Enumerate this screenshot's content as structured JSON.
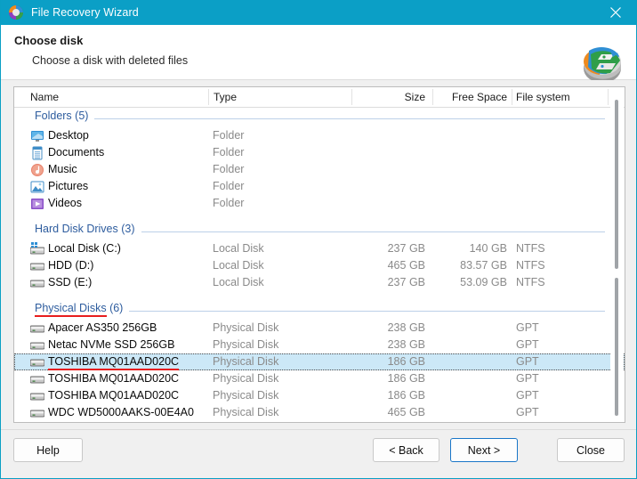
{
  "window": {
    "title": "File Recovery Wizard",
    "app_icon": "recovery-wizard-icon",
    "close_icon": "close-icon",
    "titlebar_color": "#0b9fc6"
  },
  "header": {
    "title": "Choose disk",
    "subtitle": "Choose a disk with deleted files",
    "icon": "disk-recovery-illustration"
  },
  "columns": [
    {
      "key": "name",
      "label": "Name"
    },
    {
      "key": "type",
      "label": "Type"
    },
    {
      "key": "size",
      "label": "Size"
    },
    {
      "key": "free",
      "label": "Free Space"
    },
    {
      "key": "fs",
      "label": "File system"
    }
  ],
  "groups": [
    {
      "name": "Folders",
      "count": "(5)",
      "annotated": false,
      "rows": [
        {
          "icon": "desktop-folder-icon",
          "name": "Desktop",
          "type": "Folder",
          "size": "",
          "free": "",
          "fs": "",
          "selected": false,
          "annotated": false
        },
        {
          "icon": "documents-folder-icon",
          "name": "Documents",
          "type": "Folder",
          "size": "",
          "free": "",
          "fs": "",
          "selected": false,
          "annotated": false
        },
        {
          "icon": "music-folder-icon",
          "name": "Music",
          "type": "Folder",
          "size": "",
          "free": "",
          "fs": "",
          "selected": false,
          "annotated": false
        },
        {
          "icon": "pictures-folder-icon",
          "name": "Pictures",
          "type": "Folder",
          "size": "",
          "free": "",
          "fs": "",
          "selected": false,
          "annotated": false
        },
        {
          "icon": "videos-folder-icon",
          "name": "Videos",
          "type": "Folder",
          "size": "",
          "free": "",
          "fs": "",
          "selected": false,
          "annotated": false
        }
      ]
    },
    {
      "name": "Hard Disk Drives",
      "count": "(3)",
      "annotated": false,
      "rows": [
        {
          "icon": "system-drive-icon",
          "name": "Local Disk (C:)",
          "type": "Local Disk",
          "size": "237 GB",
          "free": "140 GB",
          "fs": "NTFS",
          "selected": false,
          "annotated": false
        },
        {
          "icon": "drive-icon",
          "name": "HDD (D:)",
          "type": "Local Disk",
          "size": "465 GB",
          "free": "83.57 GB",
          "fs": "NTFS",
          "selected": false,
          "annotated": false
        },
        {
          "icon": "drive-icon",
          "name": "SSD (E:)",
          "type": "Local Disk",
          "size": "237 GB",
          "free": "53.09 GB",
          "fs": "NTFS",
          "selected": false,
          "annotated": false
        }
      ]
    },
    {
      "name": "Physical Disks",
      "count": "(6)",
      "annotated": true,
      "rows": [
        {
          "icon": "drive-icon",
          "name": "Apacer AS350 256GB",
          "type": "Physical Disk",
          "size": "238 GB",
          "free": "",
          "fs": "GPT",
          "selected": false,
          "annotated": false
        },
        {
          "icon": "drive-icon",
          "name": "Netac NVMe SSD 256GB",
          "type": "Physical Disk",
          "size": "238 GB",
          "free": "",
          "fs": "GPT",
          "selected": false,
          "annotated": false
        },
        {
          "icon": "drive-icon",
          "name": "TOSHIBA MQ01AAD020C",
          "type": "Physical Disk",
          "size": "186 GB",
          "free": "",
          "fs": "GPT",
          "selected": true,
          "annotated": true
        },
        {
          "icon": "drive-icon",
          "name": "TOSHIBA MQ01AAD020C",
          "type": "Physical Disk",
          "size": "186 GB",
          "free": "",
          "fs": "GPT",
          "selected": false,
          "annotated": false
        },
        {
          "icon": "drive-icon",
          "name": "TOSHIBA MQ01AAD020C",
          "type": "Physical Disk",
          "size": "186 GB",
          "free": "",
          "fs": "GPT",
          "selected": false,
          "annotated": false
        },
        {
          "icon": "drive-icon",
          "name": "WDC WD5000AAKS-00E4A0",
          "type": "Physical Disk",
          "size": "465 GB",
          "free": "",
          "fs": "GPT",
          "selected": false,
          "annotated": false
        }
      ]
    }
  ],
  "footer": {
    "help": "Help",
    "back": "< Back",
    "next": "Next >",
    "close": "Close",
    "default_button": "next"
  },
  "annotation_color": "#e81e1e"
}
